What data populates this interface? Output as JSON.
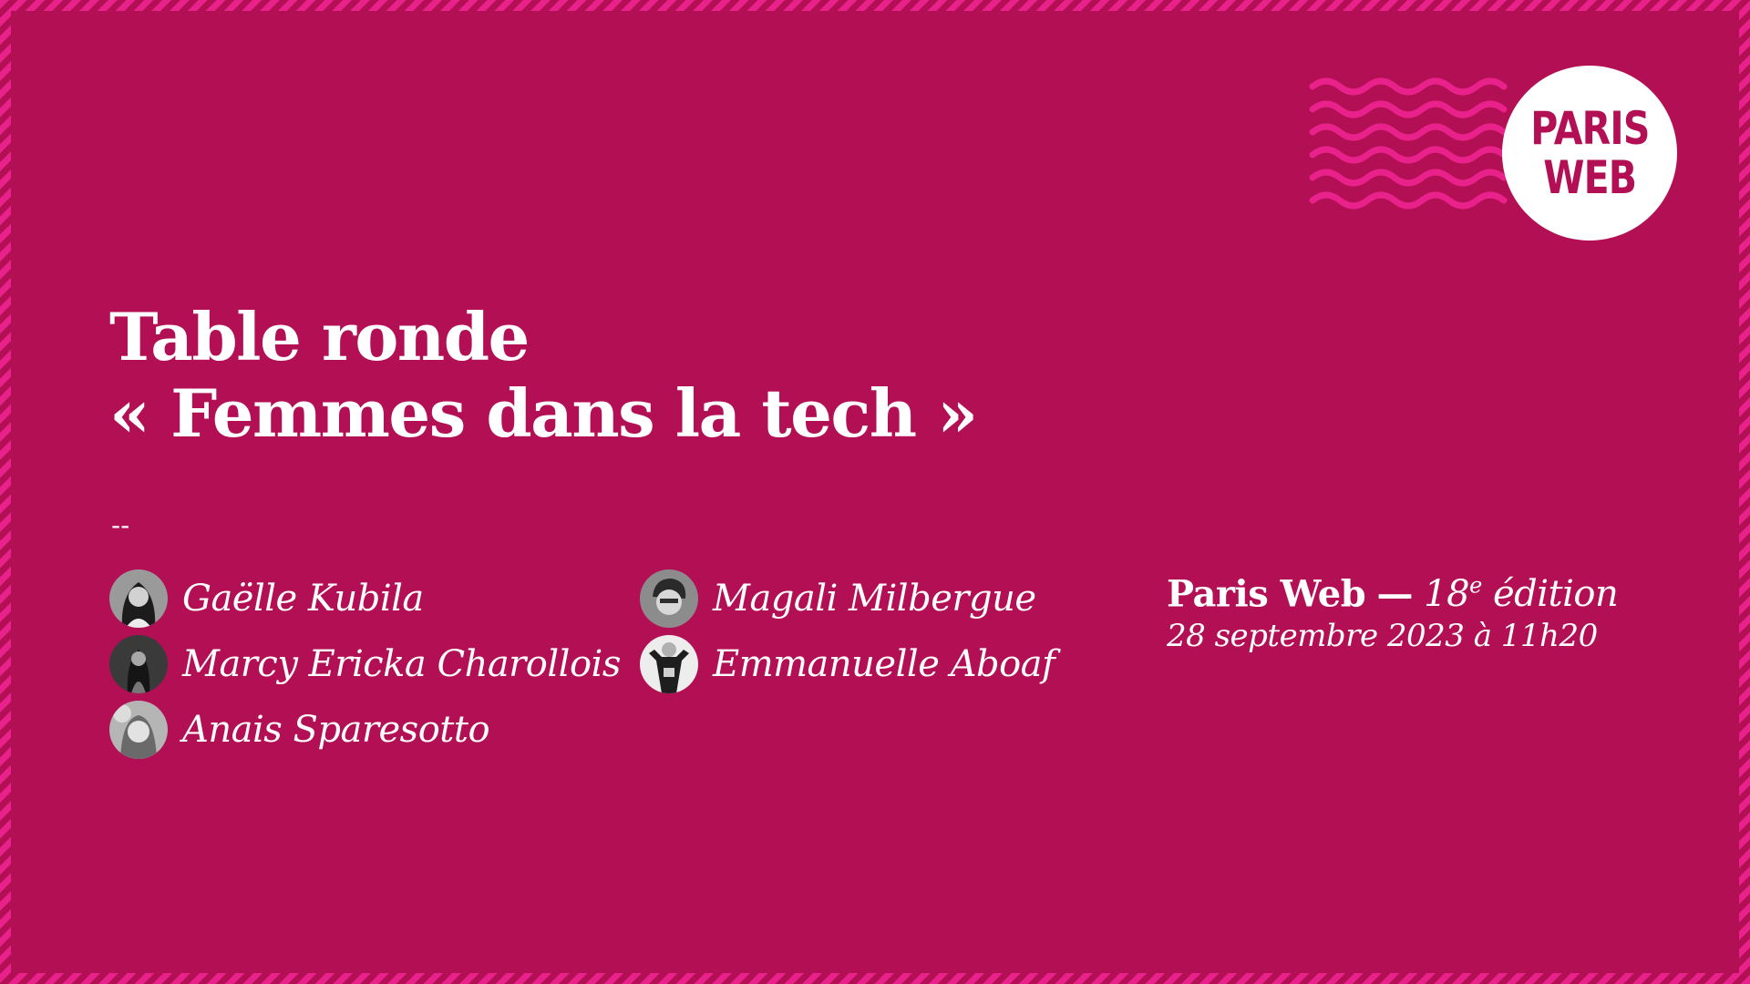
{
  "colors": {
    "background": "#b30f55",
    "border_stripe": "#e8228a",
    "text": "#ffffff",
    "logo_background": "#ffffff",
    "logo_text": "#b30f55"
  },
  "logo": {
    "line1": "PARIS",
    "line2": "WEB"
  },
  "title": {
    "line1": "Table ronde",
    "line2": "« Femmes dans la tech »"
  },
  "separator": "--",
  "speakers": [
    {
      "name": "Gaëlle Kubila",
      "avatar": "portrait-photo"
    },
    {
      "name": "Marcy Ericka Charollois",
      "avatar": "portrait-photo"
    },
    {
      "name": "Anais Sparesotto",
      "avatar": "portrait-photo"
    },
    {
      "name": "Magali Milbergue",
      "avatar": "portrait-photo"
    },
    {
      "name": "Emmanuelle Aboaf",
      "avatar": "portrait-photo"
    }
  ],
  "event": {
    "name": "Paris Web",
    "dash": "—",
    "edition_number": "18",
    "edition_suffix": "e",
    "edition_word": "édition",
    "date": "28 septembre 2023 à 11h20"
  }
}
